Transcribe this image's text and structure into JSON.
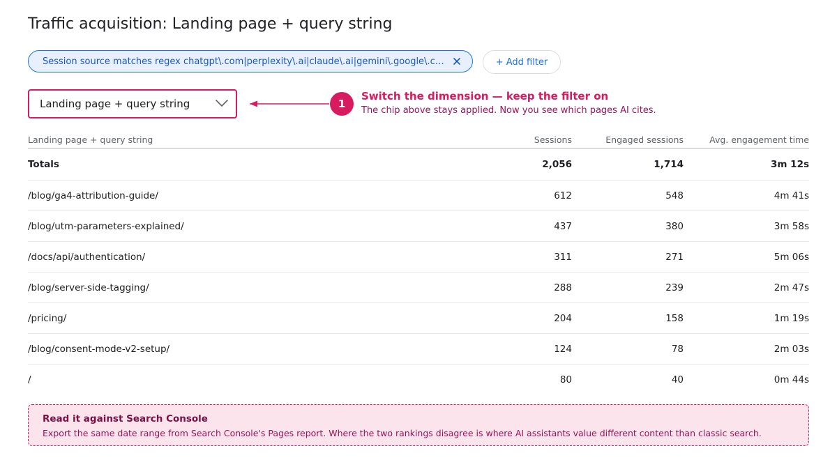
{
  "page": {
    "title": "Traffic acquisition: Landing page + query string"
  },
  "filters": {
    "chip_text": "Session source matches regex chatgpt\\.com|perplexity\\.ai|claude\\.ai|gemini\\.google\\.com...",
    "add_filter_label": "+ Add filter"
  },
  "dimension": {
    "selected": "Landing page + query string"
  },
  "callout": {
    "step": "1",
    "title": "Switch the dimension — keep the filter on",
    "body": "The chip above stays applied. Now you see which pages AI cites."
  },
  "table": {
    "headers": {
      "dimension": "Landing page + query string",
      "sessions": "Sessions",
      "engaged": "Engaged sessions",
      "time": "Avg. engagement time"
    },
    "totals": {
      "label": "Totals",
      "sessions": "2,056",
      "engaged": "1,714",
      "time": "3m 12s"
    },
    "rows": [
      {
        "page": "/blog/ga4-attribution-guide/",
        "sessions": "612",
        "engaged": "548",
        "time": "4m 41s"
      },
      {
        "page": "/blog/utm-parameters-explained/",
        "sessions": "437",
        "engaged": "380",
        "time": "3m 58s"
      },
      {
        "page": "/docs/api/authentication/",
        "sessions": "311",
        "engaged": "271",
        "time": "5m 06s"
      },
      {
        "page": "/blog/server-side-tagging/",
        "sessions": "288",
        "engaged": "239",
        "time": "2m 47s"
      },
      {
        "page": "/pricing/",
        "sessions": "204",
        "engaged": "158",
        "time": "1m 19s"
      },
      {
        "page": "/blog/consent-mode-v2-setup/",
        "sessions": "124",
        "engaged": "78",
        "time": "2m 03s"
      },
      {
        "page": "/",
        "sessions": "80",
        "engaged": "40",
        "time": "0m 44s"
      }
    ]
  },
  "note": {
    "title": "Read it against Search Console",
    "body": "Export the same date range from Search Console's Pages report. Where the two rankings disagree is where AI assistants value different content than classic search."
  },
  "colors": {
    "accent": "#d81b60",
    "link_blue": "#1a73e8",
    "chip_bg": "#e8f0fe",
    "note_bg": "#fce4ec"
  },
  "icons": {
    "chip_close": "close-icon",
    "select_toggle": "chevron-down-icon",
    "callout_pointer": "arrow-left-icon"
  }
}
